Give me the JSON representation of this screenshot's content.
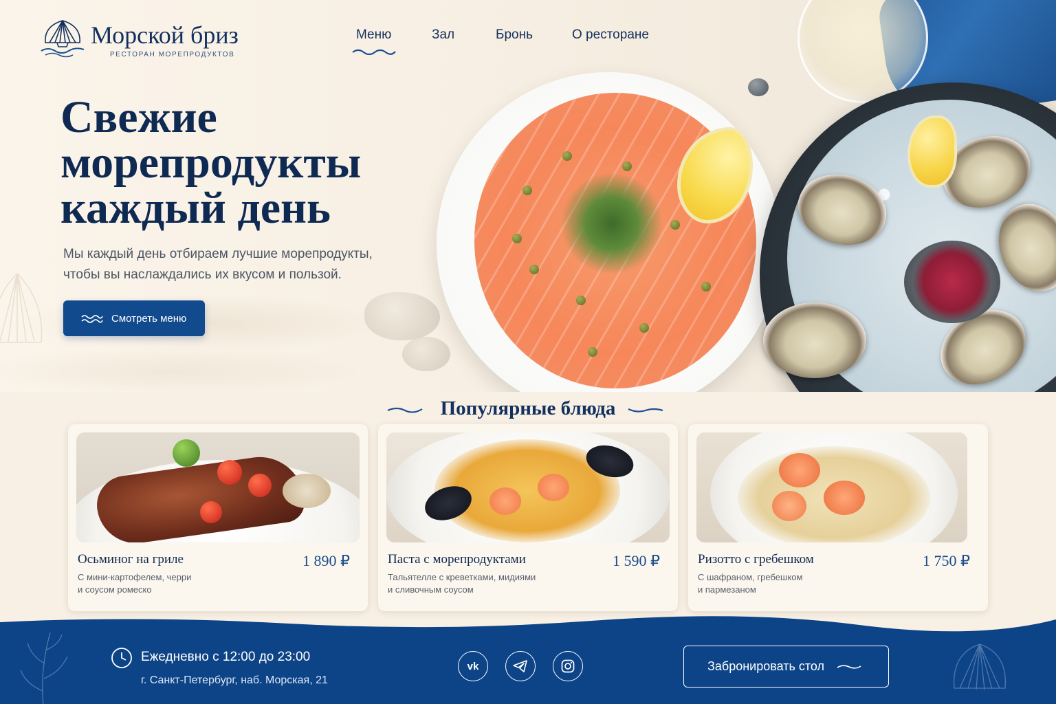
{
  "brand": {
    "name": "Морской бриз",
    "tagline": "РЕСТОРАН МОРЕПРОДУКТОВ"
  },
  "nav": {
    "items": [
      "Меню",
      "Зал",
      "Бронь",
      "О ресторане"
    ],
    "active": "Меню"
  },
  "hero": {
    "title_lines": [
      "Свежие",
      "морепродукты",
      "каждый день"
    ],
    "description_lines": [
      "Мы каждый день отбираем лучшие морепродукты,",
      "чтобы вы наслаждались их вкусом и пользой."
    ],
    "cta_label": "Смотреть меню"
  },
  "popular": {
    "title": "Популярные блюда",
    "dishes": [
      {
        "name": "Осьминог на гриле",
        "price": "1 890 ₽",
        "description_lines": [
          "С мини-картофелем, черри",
          "и соусом ромеско"
        ]
      },
      {
        "name": "Паста с морепродуктами",
        "price": "1 590 ₽",
        "description_lines": [
          "Тальятелле с креветками, мидиями",
          "и сливочным соусом"
        ]
      },
      {
        "name": "Ризотто с гребешком",
        "price": "1 750 ₽",
        "description_lines": [
          "С шафраном, гребешком",
          "и пармезаном"
        ]
      }
    ]
  },
  "footer": {
    "hours": "Ежедневно с 12:00 до 23:00",
    "address": "г. Санкт-Петербург, наб. Морская, 21",
    "socials": [
      "vk-icon",
      "telegram-icon",
      "instagram-icon"
    ],
    "book_label": "Забронировать стол"
  },
  "colors": {
    "primary": "#124a8e",
    "text_dark": "#0f2a52",
    "background": "#f8f0e4",
    "footer": "#0d4488"
  }
}
